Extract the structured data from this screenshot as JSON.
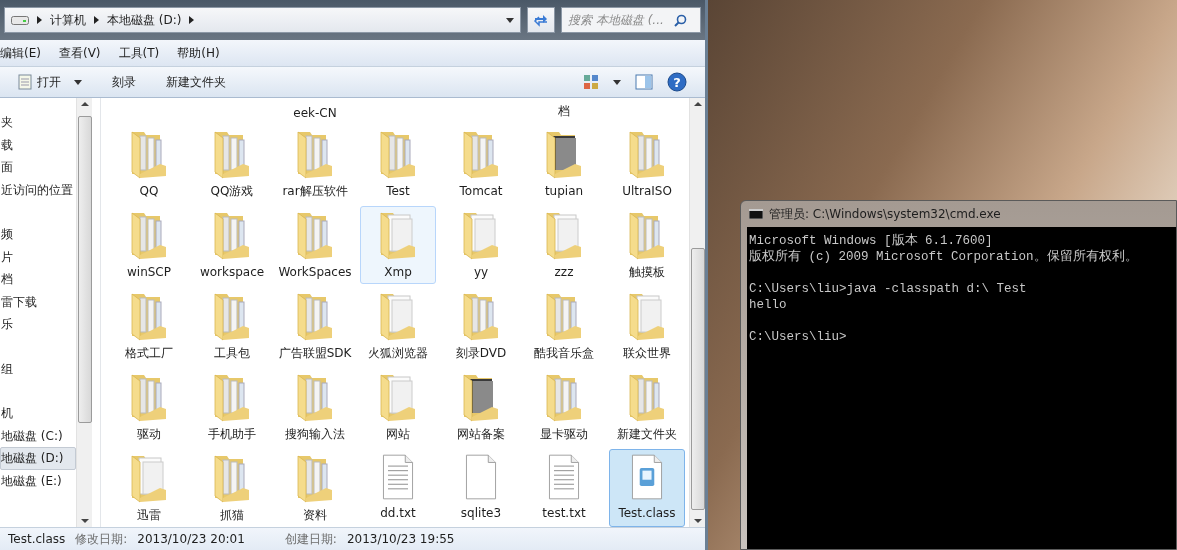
{
  "explorer": {
    "breadcrumb": [
      "计算机",
      "本地磁盘 (D:)"
    ],
    "search": {
      "placeholder": "搜索 本地磁盘 (..."
    },
    "menu": [
      "编辑(E)",
      "查看(V)",
      "工具(T)",
      "帮助(H)"
    ],
    "toolbar": [
      {
        "label": "打开",
        "kind": "open"
      },
      {
        "label": "刻录",
        "kind": "plain"
      },
      {
        "label": "新建文件夹",
        "kind": "plain"
      }
    ],
    "help": "?",
    "sidebar": {
      "groups": [
        [
          {
            "label": "夹",
            "selected": false
          },
          {
            "label": "载",
            "selected": false
          },
          {
            "label": "面",
            "selected": false
          },
          {
            "label": "近访问的位置",
            "selected": false
          }
        ],
        [
          {
            "label": "频",
            "selected": false
          },
          {
            "label": "片",
            "selected": false
          },
          {
            "label": "档",
            "selected": false
          },
          {
            "label": "雷下载",
            "selected": false
          },
          {
            "label": "乐",
            "selected": false
          }
        ],
        [
          {
            "label": "组",
            "selected": false
          }
        ],
        [
          {
            "label": "机",
            "selected": false
          },
          {
            "label": "地磁盘 (C:)",
            "selected": false
          },
          {
            "label": "地磁盘 (D:)",
            "selected": true
          },
          {
            "label": "地磁盘 (E:)",
            "selected": false
          }
        ]
      ]
    },
    "cut_row": [
      {
        "selected": false
      },
      {
        "selected": false
      },
      {
        "label": "eek-CN",
        "selected": false
      },
      {
        "selected": false
      },
      {
        "selected": false
      },
      {
        "label": "档",
        "selected": false
      },
      {
        "selected": false
      }
    ],
    "files": [
      {
        "label": "QQ",
        "kind": "folder",
        "selected": false,
        "hovered": false
      },
      {
        "label": "QQ游戏",
        "kind": "folder",
        "selected": false,
        "hovered": false
      },
      {
        "label": "rar解压软件",
        "kind": "folder",
        "selected": false,
        "hovered": false
      },
      {
        "label": "Test",
        "kind": "folder",
        "selected": false,
        "hovered": false
      },
      {
        "label": "Tomcat",
        "kind": "folder",
        "selected": false,
        "hovered": false
      },
      {
        "label": "tupian",
        "kind": "photo-folder",
        "selected": false,
        "hovered": false
      },
      {
        "label": "UltraISO",
        "kind": "folder",
        "selected": false,
        "hovered": false
      },
      {
        "label": "winSCP",
        "kind": "folder",
        "selected": false,
        "hovered": false
      },
      {
        "label": "workspace",
        "kind": "folder",
        "selected": false,
        "hovered": false
      },
      {
        "label": "WorkSpaces",
        "kind": "folder",
        "selected": false,
        "hovered": false
      },
      {
        "label": "Xmp",
        "kind": "doc-folder",
        "selected": false,
        "hovered": true
      },
      {
        "label": "yy",
        "kind": "doc-folder",
        "selected": false,
        "hovered": false
      },
      {
        "label": "zzz",
        "kind": "doc-folder",
        "selected": false,
        "hovered": false
      },
      {
        "label": "触摸板",
        "kind": "folder",
        "selected": false,
        "hovered": false
      },
      {
        "label": "格式工厂",
        "kind": "folder",
        "selected": false,
        "hovered": false
      },
      {
        "label": "工具包",
        "kind": "folder",
        "selected": false,
        "hovered": false
      },
      {
        "label": "广告联盟SDK",
        "kind": "folder",
        "selected": false,
        "hovered": false
      },
      {
        "label": "火狐浏览器",
        "kind": "doc-folder",
        "selected": false,
        "hovered": false
      },
      {
        "label": "刻录DVD",
        "kind": "folder",
        "selected": false,
        "hovered": false
      },
      {
        "label": "酷我音乐盒",
        "kind": "folder",
        "selected": false,
        "hovered": false
      },
      {
        "label": "联众世界",
        "kind": "doc-folder",
        "selected": false,
        "hovered": false
      },
      {
        "label": "驱动",
        "kind": "folder",
        "selected": false,
        "hovered": false
      },
      {
        "label": "手机助手",
        "kind": "folder",
        "selected": false,
        "hovered": false
      },
      {
        "label": "搜狗输入法",
        "kind": "folder",
        "selected": false,
        "hovered": false
      },
      {
        "label": "网站",
        "kind": "doc-folder",
        "selected": false,
        "hovered": false
      },
      {
        "label": "网站备案",
        "kind": "photo-folder",
        "selected": false,
        "hovered": false
      },
      {
        "label": "显卡驱动",
        "kind": "folder",
        "selected": false,
        "hovered": false
      },
      {
        "label": "新建文件夹",
        "kind": "folder",
        "selected": false,
        "hovered": false
      },
      {
        "label": "迅雷",
        "kind": "doc-folder",
        "selected": false,
        "hovered": false
      },
      {
        "label": "抓猫",
        "kind": "folder",
        "selected": false,
        "hovered": false
      },
      {
        "label": "资料",
        "kind": "folder",
        "selected": false,
        "hovered": false
      },
      {
        "label": "dd.txt",
        "kind": "text-file",
        "selected": false,
        "hovered": false
      },
      {
        "label": "sqlite3",
        "kind": "blank-file",
        "selected": false,
        "hovered": false
      },
      {
        "label": "test.txt",
        "kind": "text-file",
        "selected": false,
        "hovered": false
      },
      {
        "label": "Test.class",
        "kind": "class-file",
        "selected": true,
        "hovered": false
      }
    ],
    "status": {
      "name": "Test.class",
      "modified_label": "修改日期:",
      "modified": "2013/10/23 20:01",
      "created_label": "创建日期:",
      "created": "2013/10/23 19:55"
    }
  },
  "console": {
    "title": "管理员: C:\\Windows\\system32\\cmd.exe",
    "blocks": [
      [
        "Microsoft Windows [版本 6.1.7600]",
        "版权所有 (c) 2009 Microsoft Corporation。保留所有权利。"
      ],
      [
        "C:\\Users\\liu>java -classpath d:\\ Test",
        "hello"
      ],
      [
        "C:\\Users\\liu>"
      ]
    ]
  }
}
